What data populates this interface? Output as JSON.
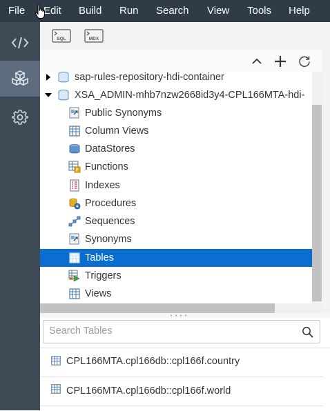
{
  "menubar": {
    "items": [
      "File",
      "Edit",
      "Build",
      "Run",
      "Search",
      "View",
      "Tools",
      "Help"
    ]
  },
  "sidebar": {
    "items": [
      {
        "icon": "code-icon",
        "active": false
      },
      {
        "icon": "database-explorer-icon",
        "active": true
      },
      {
        "icon": "gear-icon",
        "active": false
      }
    ]
  },
  "toolbar": {
    "buttons": [
      {
        "icon": "open-sql-console-icon",
        "label": "SQL"
      },
      {
        "icon": "open-mdx-console-icon",
        "label": "MDX"
      }
    ]
  },
  "tree_header": {
    "buttons": [
      "collapse-icon",
      "add-icon",
      "refresh-icon"
    ]
  },
  "tree": {
    "containers": [
      {
        "label": "sap-rules-repository-hdi-container",
        "expanded": false
      },
      {
        "label": "XSA_ADMIN-mhb7nzw2668id3y4-CPL166MTA-hdi-",
        "expanded": true
      }
    ],
    "items": [
      {
        "label": "Public Synonyms",
        "icon": "public-synonym-icon"
      },
      {
        "label": "Column Views",
        "icon": "column-view-icon"
      },
      {
        "label": "DataStores",
        "icon": "datastore-icon"
      },
      {
        "label": "Functions",
        "icon": "function-icon"
      },
      {
        "label": "Indexes",
        "icon": "index-icon"
      },
      {
        "label": "Procedures",
        "icon": "procedure-icon"
      },
      {
        "label": "Sequences",
        "icon": "sequence-icon"
      },
      {
        "label": "Synonyms",
        "icon": "synonym-icon"
      },
      {
        "label": "Tables",
        "icon": "table-icon",
        "selected": true
      },
      {
        "label": "Triggers",
        "icon": "trigger-icon"
      },
      {
        "label": "Views",
        "icon": "view-icon"
      }
    ],
    "selected_color": "#0a6ed1"
  },
  "search": {
    "placeholder": "Search Tables",
    "value": ""
  },
  "results": [
    {
      "label": "CPL166MTA.cpl166db::cpl166f.country",
      "icon": "table-icon"
    },
    {
      "label": "CPL166MTA.cpl166db::cpl166f.world",
      "icon": "table-icon"
    }
  ]
}
